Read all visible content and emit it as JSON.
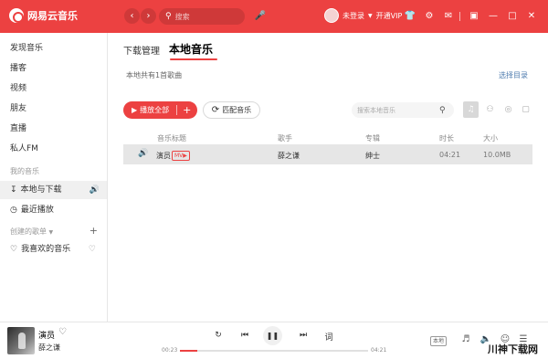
{
  "app": {
    "name": "网易云音乐",
    "search_placeholder": "搜索",
    "user_status": "未登录",
    "vip_label": "开通VIP",
    "icons": [
      "back-icon",
      "forward-icon",
      "search-icon",
      "mic-icon",
      "tshirt-icon",
      "settings-icon",
      "mail-icon",
      "mini-mode-icon",
      "minimize-icon",
      "maximize-icon",
      "close-icon"
    ],
    "accent_color": "#ec4141"
  },
  "sidebar": {
    "items": [
      {
        "label": "发现音乐"
      },
      {
        "label": "播客"
      },
      {
        "label": "视频"
      },
      {
        "label": "朋友"
      },
      {
        "label": "直播"
      },
      {
        "label": "私人FM"
      }
    ],
    "my_music_header": "我的音乐",
    "my_music_items": [
      {
        "label": "本地与下载",
        "icon": "download-icon",
        "active": true
      },
      {
        "label": "最近播放",
        "icon": "recent-icon"
      }
    ],
    "created_header": "创建的歌单",
    "created_items": [
      {
        "label": "我喜欢的音乐",
        "icon": "heart-icon"
      }
    ]
  },
  "main": {
    "tabs": [
      {
        "label": "下载管理"
      },
      {
        "label": "本地音乐",
        "active": true
      }
    ],
    "summary": "本地共有1首歌曲",
    "choose_dir": "选择目录",
    "play_all": "播放全部",
    "match_music": "匹配音乐",
    "local_search_placeholder": "搜索本地音乐",
    "table": {
      "headers": [
        "音乐标题",
        "歌手",
        "专辑",
        "时长",
        "大小"
      ],
      "rows": [
        {
          "title": "演员",
          "badge": "MV▶",
          "artist": "薛之谦",
          "album": "绅士",
          "duration": "04:21",
          "size": "10.0MB"
        }
      ]
    }
  },
  "player": {
    "title": "演员",
    "artist": "薛之谦",
    "current_time": "00:23",
    "total_time": "04:21",
    "progress": 0.09,
    "quality": "本地"
  },
  "watermark": "川神下载网"
}
